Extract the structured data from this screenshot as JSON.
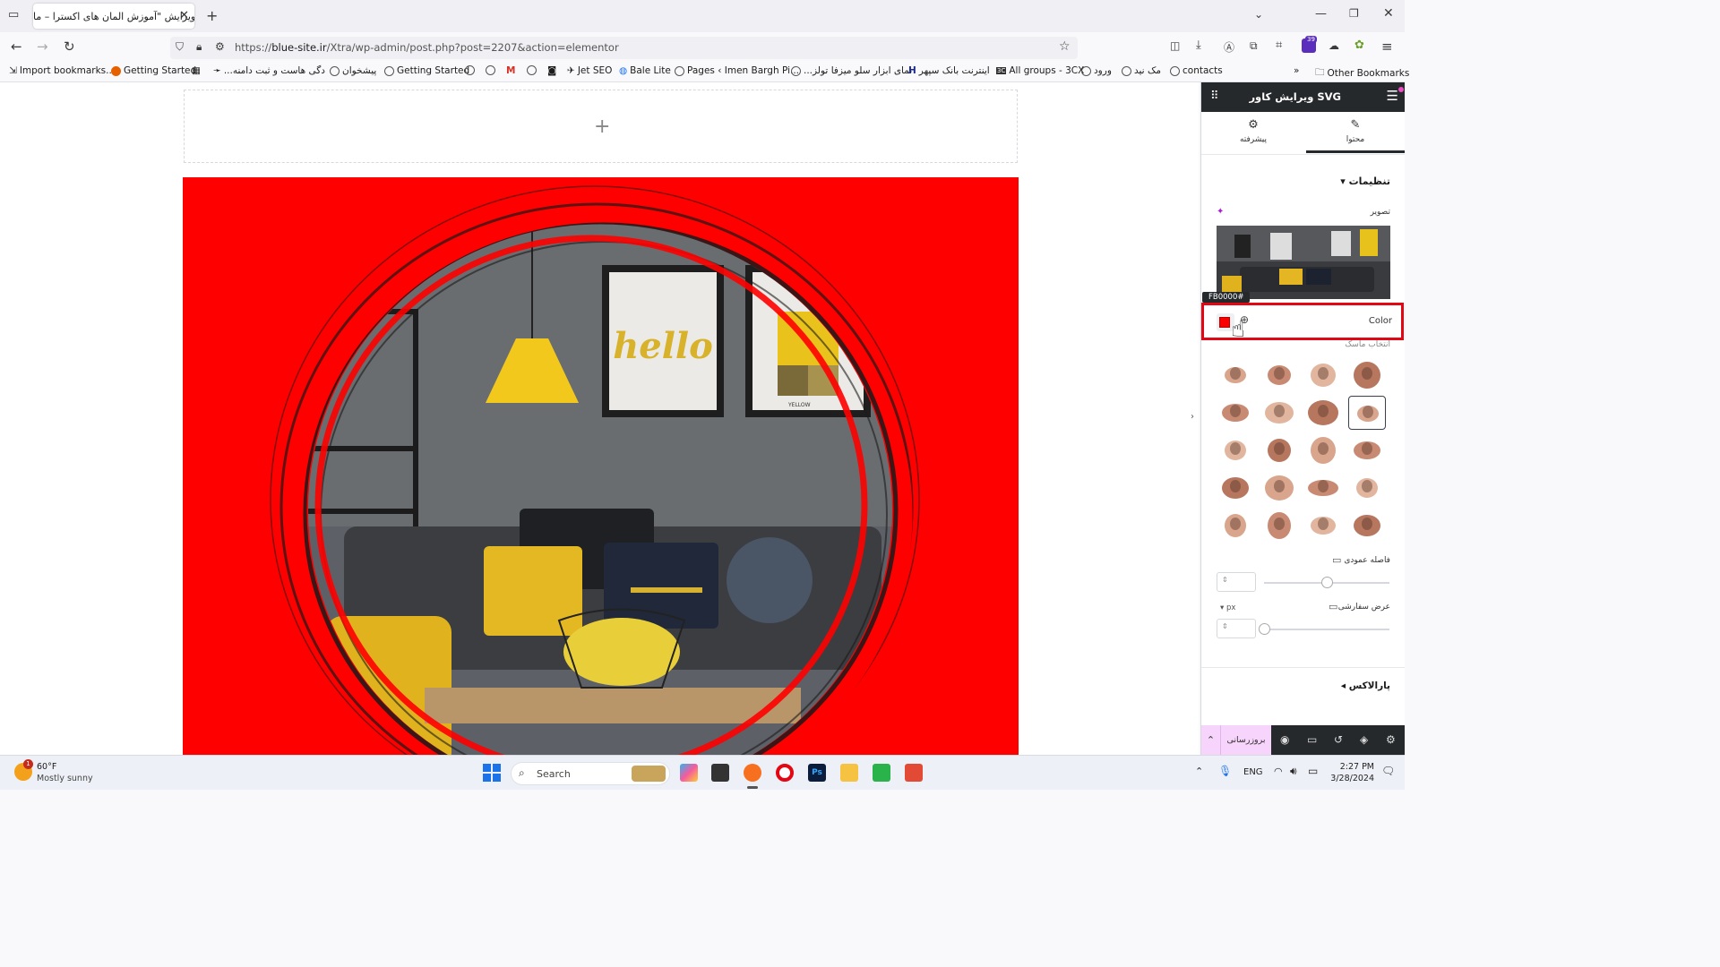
{
  "browser": {
    "tab_title": "ویرایش \"آموزش المان های اکسترا – ما",
    "tab_close": "✕",
    "new_tab": "+",
    "url_prefix": "https://",
    "url_host": "blue-site.ir",
    "url_path": "/Xtra/wp-admin/post.php?post=2207&action=elementor",
    "extensions_badge": "39",
    "bookmarks": [
      "Import bookmarks...",
      "Getting Started",
      "دگی هاست و ثبت دامنه...",
      "پیشخوان",
      "Getting Started",
      "Jet SEO",
      "Bale Lite",
      "Pages ‹ Imen Bargh Pi...",
      "نمای ابزار سلو میزفا تولز...",
      "اینترنت بانک سپهر",
      "All groups - 3CX",
      "ورود",
      "مک نید",
      "contacts"
    ],
    "other_bookmarks": "Other Bookmarks"
  },
  "canvas": {
    "add_section": "+",
    "image_text_hello": "hello",
    "image_text_yellow": "YELLOW"
  },
  "panel": {
    "title": "ویرایش کاور SVG",
    "tab_content": "محتوا",
    "tab_advanced": "پیشرفته",
    "section_settings": "تنظیمات",
    "image_label": "تصویر",
    "tooltip_hex": "FB0000#",
    "color_label": "Color",
    "mask_label": "انتخاب ماسک",
    "vertical_spacing_label": "فاصله عمودی",
    "custom_width_label": "عرض سفارشی",
    "unit_px": "px",
    "section_parallax": "پارالاکس",
    "update_button": "بروزرسانی",
    "vertical_spacing_value": 0.5,
    "custom_width_value": 0
  },
  "colors": {
    "cover_color": "#FB0000",
    "panel_dark": "#26292c",
    "highlight": "#e30613",
    "update_bg": "#f7d4fb"
  },
  "taskbar": {
    "weather_temp": "60°F",
    "weather_desc": "Mostly sunny",
    "weather_badge": "1",
    "search_placeholder": "Search",
    "lang": "ENG",
    "time": "2:27 PM",
    "date": "3/28/2024"
  }
}
